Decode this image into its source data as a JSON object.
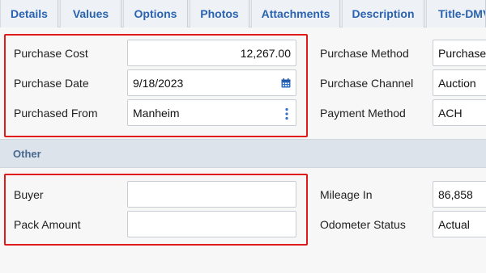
{
  "tabs": [
    {
      "label": "Details"
    },
    {
      "label": "Values"
    },
    {
      "label": "Options"
    },
    {
      "label": "Photos"
    },
    {
      "label": "Attachments"
    },
    {
      "label": "Description"
    },
    {
      "label": "Title-DMV"
    }
  ],
  "purchase": {
    "cost_label": "Purchase Cost",
    "cost_value": "12,267.00",
    "date_label": "Purchase Date",
    "date_value": "9/18/2023",
    "from_label": "Purchased From",
    "from_value": "Manheim",
    "method_label": "Purchase Method",
    "method_value": "Purchase f",
    "channel_label": "Purchase Channel",
    "channel_value": "Auction",
    "payment_label": "Payment Method",
    "payment_value": "ACH"
  },
  "other": {
    "section_title": "Other",
    "buyer_label": "Buyer",
    "buyer_value": "",
    "pack_label": "Pack Amount",
    "pack_value": "",
    "mileage_label": "Mileage In",
    "mileage_value": "86,858",
    "odometer_label": "Odometer Status",
    "odometer_value": "Actual"
  },
  "colors": {
    "tab_text": "#2a63b0",
    "highlight": "#e01a1a",
    "section_bar": "#dde3ea"
  }
}
